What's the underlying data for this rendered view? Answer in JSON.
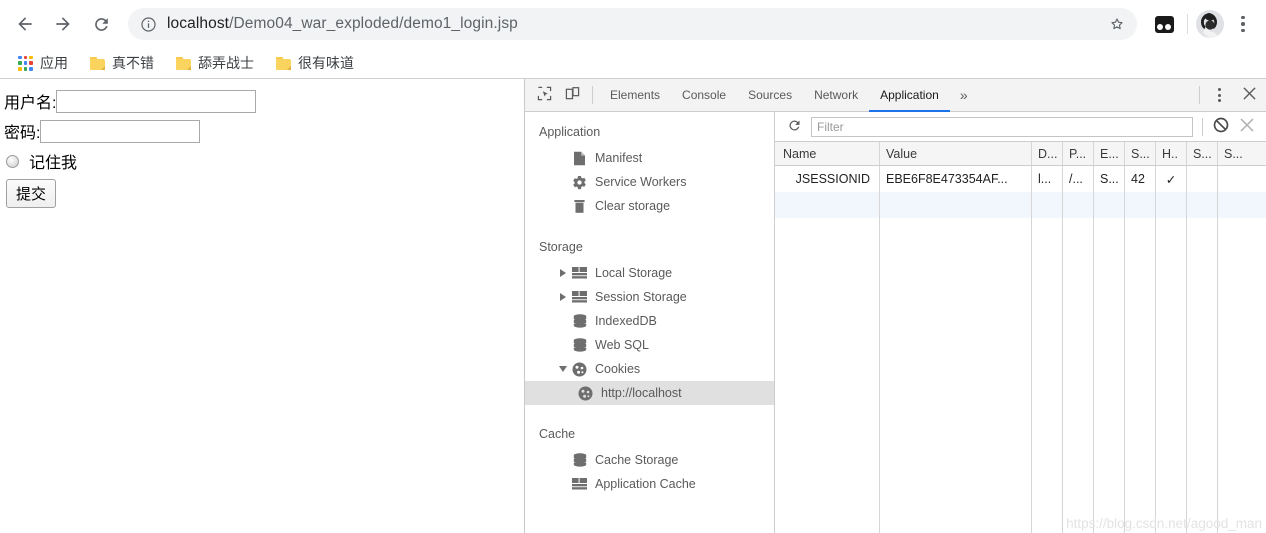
{
  "browser": {
    "back_icon": "back-arrow-icon",
    "forward_icon": "forward-arrow-icon",
    "reload_icon": "reload-icon",
    "info_icon": "page-info-icon",
    "url_host": "localhost",
    "url_path": "/Demo04_war_exploded/demo1_login.jsp",
    "url_full": "localhost/Demo04_war_exploded/demo1_login.jsp",
    "star_icon": "bookmark-star-icon",
    "extension_icon": "extension-icon",
    "avatar_icon": "user-avatar",
    "menu_icon": "chrome-menu-icon"
  },
  "bookmarks": [
    {
      "label": "应用",
      "icon": "apps-grid-icon"
    },
    {
      "label": "真不错",
      "icon": "folder-icon"
    },
    {
      "label": "舔弄战士",
      "icon": "folder-icon"
    },
    {
      "label": "很有味道",
      "icon": "folder-icon"
    }
  ],
  "page": {
    "username_label": "用户名:",
    "username_value": "",
    "password_label": "密码:",
    "password_value": "",
    "remember_label": "记住我",
    "submit_label": "提交"
  },
  "devtools": {
    "inspect_icon": "inspect-element-icon",
    "device_icon": "device-toolbar-icon",
    "tabs": [
      {
        "label": "Elements",
        "active": false
      },
      {
        "label": "Console",
        "active": false
      },
      {
        "label": "Sources",
        "active": false
      },
      {
        "label": "Network",
        "active": false
      },
      {
        "label": "Application",
        "active": true
      }
    ],
    "more_tabs_label": "»",
    "settings_icon": "devtools-menu-icon",
    "close_icon": "close-icon",
    "sidebar": {
      "sections": [
        {
          "title": "Application",
          "items": [
            {
              "label": "Manifest",
              "icon": "manifest-document-icon",
              "indent": 1,
              "twisty": "none",
              "selected": false
            },
            {
              "label": "Service Workers",
              "icon": "gear-icon",
              "indent": 1,
              "twisty": "none",
              "selected": false
            },
            {
              "label": "Clear storage",
              "icon": "trash-icon",
              "indent": 1,
              "twisty": "none",
              "selected": false
            }
          ]
        },
        {
          "title": "Storage",
          "items": [
            {
              "label": "Local Storage",
              "icon": "table-icon",
              "indent": 1,
              "twisty": "collapsed",
              "selected": false
            },
            {
              "label": "Session Storage",
              "icon": "table-icon",
              "indent": 1,
              "twisty": "collapsed",
              "selected": false
            },
            {
              "label": "IndexedDB",
              "icon": "database-icon",
              "indent": 1,
              "twisty": "none",
              "selected": false
            },
            {
              "label": "Web SQL",
              "icon": "database-icon",
              "indent": 1,
              "twisty": "none",
              "selected": false
            },
            {
              "label": "Cookies",
              "icon": "cookie-icon",
              "indent": 1,
              "twisty": "expanded",
              "selected": false
            },
            {
              "label": "http://localhost",
              "icon": "cookie-icon",
              "indent": 2,
              "twisty": "none",
              "selected": true
            }
          ]
        },
        {
          "title": "Cache",
          "items": [
            {
              "label": "Cache Storage",
              "icon": "database-icon",
              "indent": 1,
              "twisty": "none",
              "selected": false
            },
            {
              "label": "Application Cache",
              "icon": "table-icon",
              "indent": 1,
              "twisty": "none",
              "selected": false
            }
          ]
        }
      ]
    },
    "filterbar": {
      "refresh_icon": "refresh-icon",
      "filter_placeholder": "Filter",
      "filter_value": "",
      "clear_all_icon": "clear-all-cookies-icon",
      "delete_icon": "delete-selected-icon"
    },
    "cookie_table": {
      "columns": [
        "Name",
        "Value",
        "D...",
        "P...",
        "E...",
        "S...",
        "H..",
        "S...",
        "S..."
      ],
      "rows": [
        [
          "JSESSIONID",
          "EBE6F8E473354AF...",
          "l...",
          "/...",
          "S...",
          "42",
          "✓",
          "",
          ""
        ]
      ]
    }
  },
  "watermark": "https://blog.csdn.net/agood_man",
  "colors": {
    "accent": "#1a73e8",
    "omnibox_bg": "#f1f3f4",
    "selection": "#e0e0e0",
    "row_alt": "#f2f7fd"
  }
}
